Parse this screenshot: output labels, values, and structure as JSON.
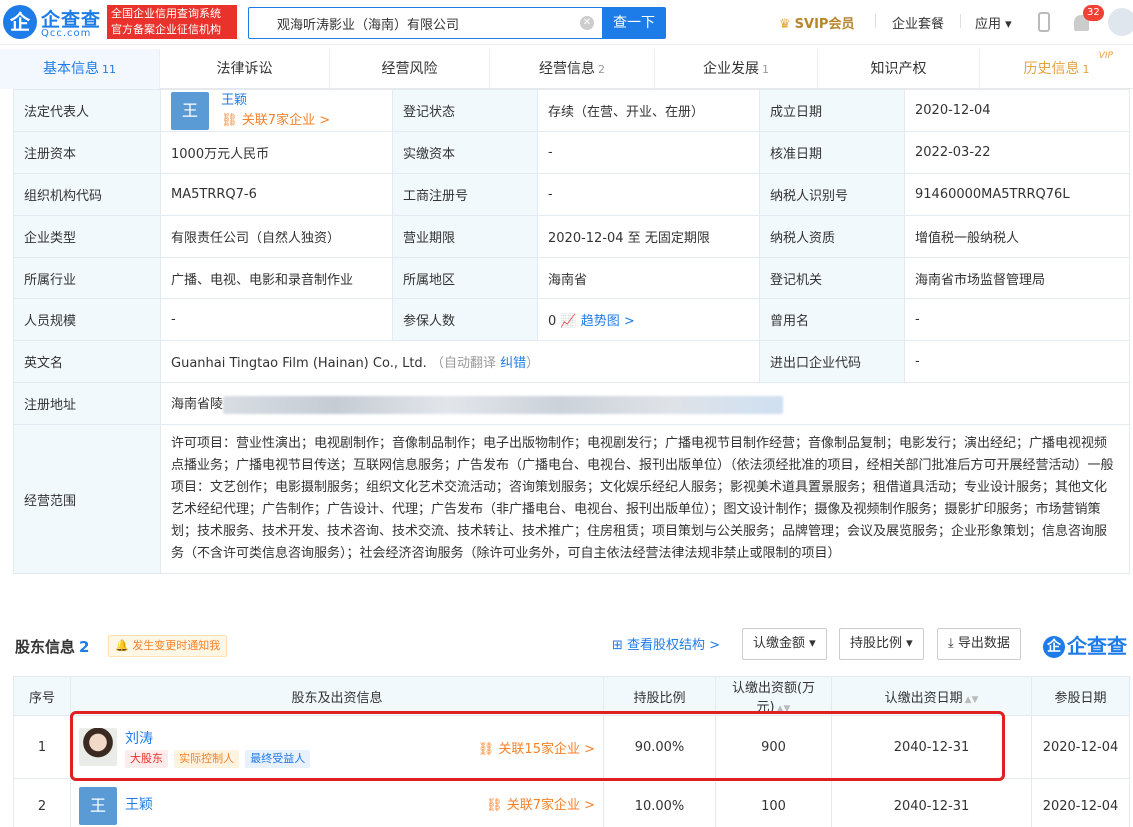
{
  "header": {
    "logo_char": "企",
    "logo_name": "企查查",
    "logo_domain": "Qcc.com",
    "slogan_line1": "全国企业信用查询系统",
    "slogan_line2": "官方备案企业征信机构",
    "search_value": "观海听涛影业（海南）有限公司",
    "search_button": "查一下",
    "svip": "SVIP会员",
    "suite": "企业套餐",
    "apps": "应用",
    "notification_count": "32"
  },
  "tabs": [
    {
      "label": "基本信息",
      "count": "11"
    },
    {
      "label": "法律诉讼",
      "count": ""
    },
    {
      "label": "经营风险",
      "count": ""
    },
    {
      "label": "经营信息",
      "count": "2"
    },
    {
      "label": "企业发展",
      "count": "1"
    },
    {
      "label": "知识产权",
      "count": ""
    },
    {
      "label": "历史信息",
      "count": "1",
      "tag": "VIP"
    }
  ],
  "info": {
    "legal_rep_label": "法定代表人",
    "legal_rep_avatar": "王",
    "legal_rep_name": "王颖",
    "legal_rep_rel": "关联7家企业 >",
    "reg_status_label": "登记状态",
    "reg_status": "存续（在营、开业、在册）",
    "est_date_label": "成立日期",
    "est_date": "2020-12-04",
    "reg_capital_label": "注册资本",
    "reg_capital": "1000万元人民币",
    "paid_capital_label": "实缴资本",
    "paid_capital": "-",
    "approve_date_label": "核准日期",
    "approve_date": "2022-03-22",
    "org_code_label": "组织机构代码",
    "org_code": "MA5TRRQ7-6",
    "biz_reg_no_label": "工商注册号",
    "biz_reg_no": "-",
    "tax_id_label": "纳税人识别号",
    "tax_id": "91460000MA5TRRQ76L",
    "type_label": "企业类型",
    "type": "有限责任公司（自然人独资）",
    "term_label": "营业期限",
    "term": "2020-12-04 至 无固定期限",
    "tax_qual_label": "纳税人资质",
    "tax_qual": "增值税一般纳税人",
    "industry_label": "所属行业",
    "industry": "广播、电视、电影和录音制作业",
    "region_label": "所属地区",
    "region": "海南省",
    "authority_label": "登记机关",
    "authority": "海南省市场监督管理局",
    "staff_label": "人员规模",
    "staff": "-",
    "insured_label": "参保人数",
    "insured": "0",
    "trend": "趋势图 >",
    "former_name_label": "曾用名",
    "former_name": "-",
    "en_name_label": "英文名",
    "en_name": "Guanhai Tingtao Film (Hainan) Co., Ltd.",
    "auto_translate": "（自动翻译",
    "correct": "纠错",
    "close_paren": "）",
    "ie_code_label": "进出口企业代码",
    "ie_code": "-",
    "address_label": "注册地址",
    "address_visible": "海南省陵",
    "scope_label": "经营范围",
    "scope": "许可项目：营业性演出；电视剧制作；音像制品制作；电子出版物制作；电视剧发行；广播电视节目制作经营；音像制品复制；电影发行；演出经纪；广播电视视频点播业务；广播电视节目传送；互联网信息服务；广告发布（广播电台、电视台、报刊出版单位）（依法须经批准的项目，经相关部门批准后方可开展经营活动）一般项目：文艺创作；电影摄制服务；组织文化艺术交流活动；咨询策划服务；文化娱乐经纪人服务；影视美术道具置景服务；租借道具活动；专业设计服务；其他文化艺术经纪代理；广告制作；广告设计、代理；广告发布（非广播电台、电视台、报刊出版单位）；图文设计制作；摄像及视频制作服务；摄影扩印服务；市场营销策划；技术服务、技术开发、技术咨询、技术交流、技术转让、技术推广；住房租赁；项目策划与公关服务；品牌管理；会议及展览服务；企业形象策划；信息咨询服务（不含许可类信息咨询服务）；社会经济咨询服务（除许可业务外，可自主依法经营法律法规非禁止或限制的项目）"
  },
  "shareholders": {
    "title": "股东信息",
    "count": "2",
    "notify": "发生变更时通知我",
    "struct_link": "查看股权结构 >",
    "btn_amount": "认缴金额",
    "btn_ratio": "持股比例",
    "btn_export": "导出数据",
    "brand": "企查查",
    "columns": [
      "序号",
      "股东及出资信息",
      "持股比例",
      "认缴出资额(万元)",
      "认缴出资日期",
      "参股日期"
    ],
    "rows": [
      {
        "no": "1",
        "name": "刘涛",
        "tags": [
          "大股东",
          "实际控制人",
          "最终受益人"
        ],
        "rel": "关联15家企业 >",
        "ratio": "90.00%",
        "amount": "900",
        "date": "2040-12-31",
        "join": "2020-12-04"
      },
      {
        "no": "2",
        "name": "王颖",
        "avatar": "王",
        "tags": [],
        "rel": "关联7家企业 >",
        "ratio": "10.00%",
        "amount": "100",
        "date": "2040-12-31",
        "join": "2020-12-04"
      }
    ]
  }
}
